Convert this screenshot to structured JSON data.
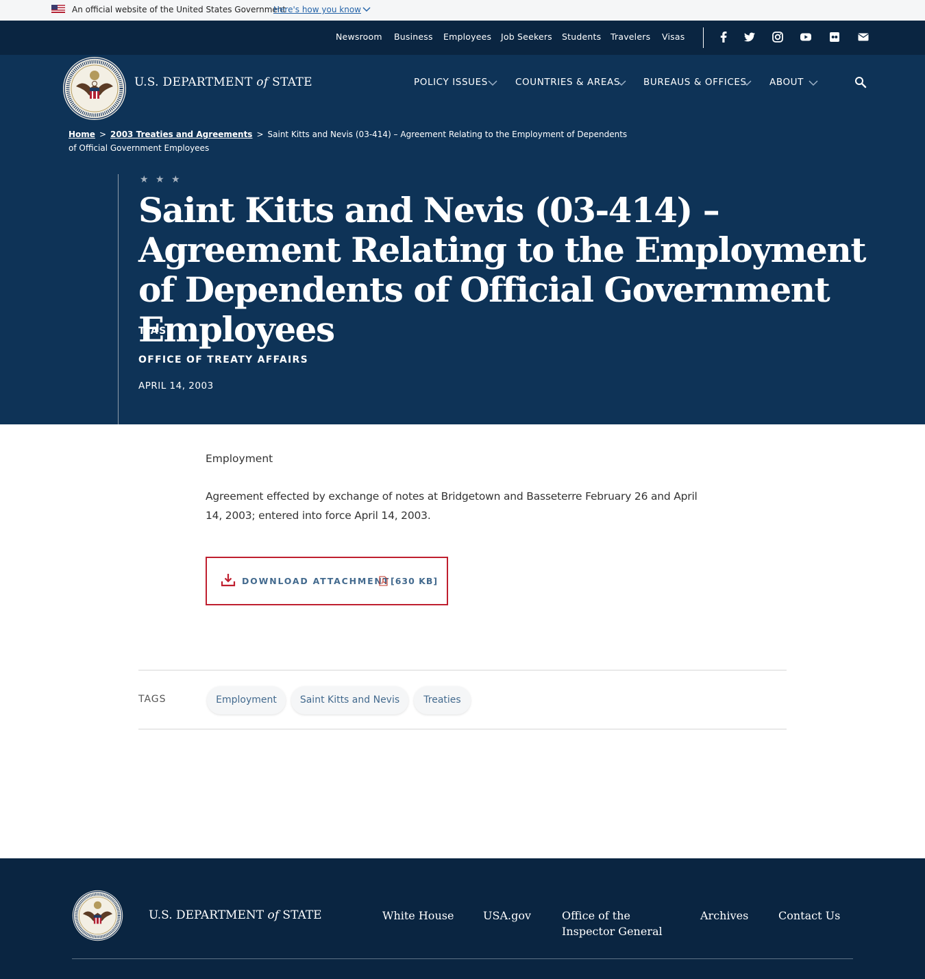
{
  "gov_banner": {
    "text": "An official website of the United States Government",
    "link": "Here's how you know"
  },
  "utility_nav": [
    "Newsroom",
    "Business",
    "Employees",
    "Job Seekers",
    "Students",
    "Travelers",
    "Visas"
  ],
  "social_icons": [
    "facebook-icon",
    "twitter-icon",
    "instagram-icon",
    "youtube-icon",
    "flickr-icon",
    "email-icon"
  ],
  "brand": {
    "pre": "U.S. DEPARTMENT ",
    "of": "of",
    "post": " STATE"
  },
  "main_nav": [
    "POLICY ISSUES",
    "COUNTRIES & AREAS",
    "BUREAUS & OFFICES",
    "ABOUT"
  ],
  "breadcrumb": {
    "home": "Home",
    "section": "2003 Treaties and Agreements",
    "current": "Saint Kitts and Nevis (03-414) – Agreement Relating to the Employment of Dependents of Official Government Employees"
  },
  "hero": {
    "stars": "★ ★ ★",
    "title": "Saint Kitts and Nevis (03-414) – Agreement Relating to the Employment of Dependents of Official Government Employees",
    "tag": "TIAS",
    "office": "OFFICE OF TREATY AFFAIRS",
    "date": "APRIL 14, 2003"
  },
  "content": {
    "lead": "Employment",
    "paragraph": "Agreement effected by exchange of notes at Bridgetown and Basseterre February 26 and April 14, 2003; entered into force April 14, 2003."
  },
  "download": {
    "label": "DOWNLOAD ATTACHMENT",
    "size": "[630 KB]"
  },
  "tags": {
    "label": "TAGS",
    "items": [
      "Employment",
      "Saint Kitts and Nevis",
      "Treaties"
    ]
  },
  "footer": {
    "brand": {
      "pre": "U.S. DEPARTMENT ",
      "of": "of",
      "post": " STATE"
    },
    "links": [
      "White House",
      "USA.gov",
      "Office of the Inspector General",
      "Archives",
      "Contact Us"
    ]
  },
  "colors": {
    "navy": "#0e3357",
    "dark_navy": "#0a2541",
    "accent_red": "#bf1e2e",
    "link_blue": "#436a8e"
  }
}
